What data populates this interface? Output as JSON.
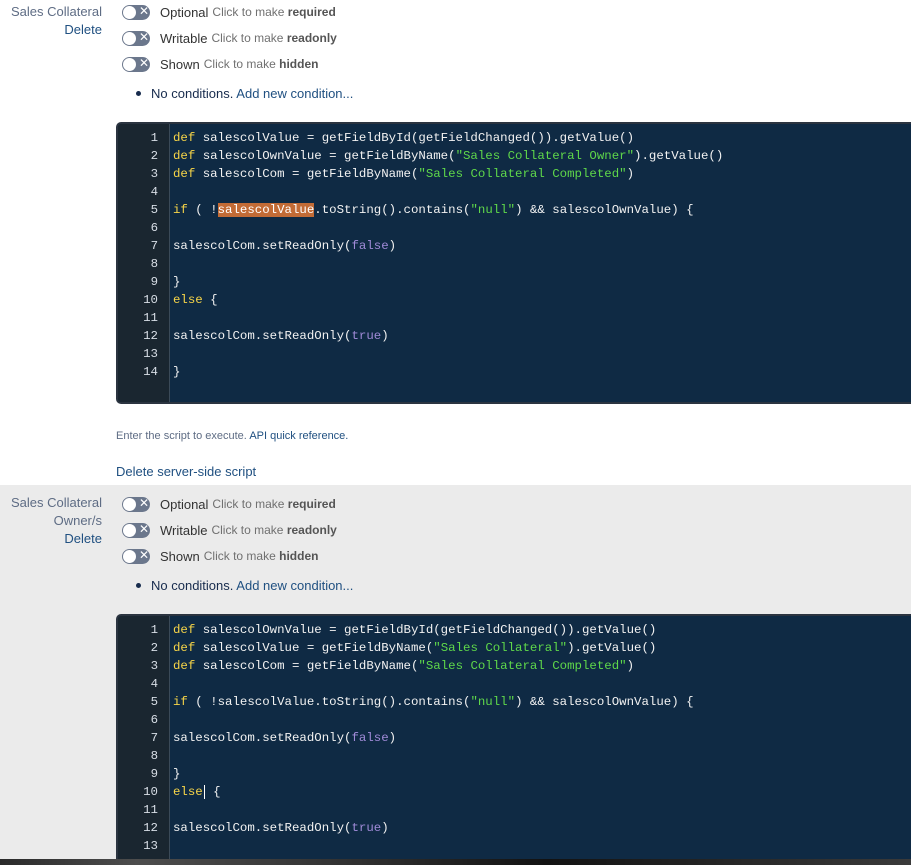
{
  "sections": [
    {
      "field_label_lines": [
        "Sales Collateral"
      ],
      "delete_label": "Delete",
      "toggles": [
        {
          "state": "Optional",
          "hint_prefix": "Click to make",
          "hint_target": "required"
        },
        {
          "state": "Writable",
          "hint_prefix": "Click to make",
          "hint_target": "readonly"
        },
        {
          "state": "Shown",
          "hint_prefix": "Click to make",
          "hint_target": "hidden"
        }
      ],
      "conditions_text": "No conditions.",
      "add_condition_label": "Add new condition...",
      "code_lines": [
        {
          "n": "1",
          "text": "def salescolValue = getFieldById(getFieldChanged()).getValue()"
        },
        {
          "n": "2",
          "text": "def salescolOwnValue = getFieldByName(\"Sales Collateral Owner\").getValue()"
        },
        {
          "n": "3",
          "text": "def salescolCom = getFieldByName(\"Sales Collateral Completed\")"
        },
        {
          "n": "4",
          "text": ""
        },
        {
          "n": "5",
          "text": "if ( !salescolValue.toString().contains(\"null\") && salescolOwnValue) {",
          "highlight": "salescolValue"
        },
        {
          "n": "6",
          "text": ""
        },
        {
          "n": "7",
          "text": "salescolCom.setReadOnly(false)"
        },
        {
          "n": "8",
          "text": ""
        },
        {
          "n": "9",
          "text": "}"
        },
        {
          "n": "10",
          "text": "else {"
        },
        {
          "n": "11",
          "text": ""
        },
        {
          "n": "12",
          "text": "salescolCom.setReadOnly(true)"
        },
        {
          "n": "13",
          "text": ""
        },
        {
          "n": "14",
          "text": "}"
        }
      ],
      "help_text": "Enter the script to execute.",
      "api_link_label": "API quick reference.",
      "delete_script_label": "Delete server-side script"
    },
    {
      "field_label_lines": [
        "Sales Collateral",
        "Owner/s"
      ],
      "delete_label": "Delete",
      "toggles": [
        {
          "state": "Optional",
          "hint_prefix": "Click to make",
          "hint_target": "required"
        },
        {
          "state": "Writable",
          "hint_prefix": "Click to make",
          "hint_target": "readonly"
        },
        {
          "state": "Shown",
          "hint_prefix": "Click to make",
          "hint_target": "hidden"
        }
      ],
      "conditions_text": "No conditions.",
      "add_condition_label": "Add new condition...",
      "code_lines": [
        {
          "n": "1",
          "text": "def salescolOwnValue = getFieldById(getFieldChanged()).getValue()"
        },
        {
          "n": "2",
          "text": "def salescolValue = getFieldByName(\"Sales Collateral\").getValue()"
        },
        {
          "n": "3",
          "text": "def salescolCom = getFieldByName(\"Sales Collateral Completed\")"
        },
        {
          "n": "4",
          "text": ""
        },
        {
          "n": "5",
          "text": "if ( !salescolValue.toString().contains(\"null\") && salescolOwnValue) {"
        },
        {
          "n": "6",
          "text": ""
        },
        {
          "n": "7",
          "text": "salescolCom.setReadOnly(false)"
        },
        {
          "n": "8",
          "text": ""
        },
        {
          "n": "9",
          "text": "}"
        },
        {
          "n": "10",
          "text": "else {",
          "cursor_after": "else {"
        },
        {
          "n": "11",
          "text": ""
        },
        {
          "n": "12",
          "text": "salescolCom.setReadOnly(true)"
        },
        {
          "n": "13",
          "text": ""
        }
      ]
    }
  ],
  "icons": {
    "toggle": "toggle-x-icon"
  },
  "colors": {
    "link": "#205081",
    "editor_bg": "#0f2a44",
    "keyword": "#f7d548",
    "string": "#5fd84a",
    "boolean": "#a08bd8",
    "highlight": "#c26b36",
    "section2_bg": "#ebebeb"
  }
}
